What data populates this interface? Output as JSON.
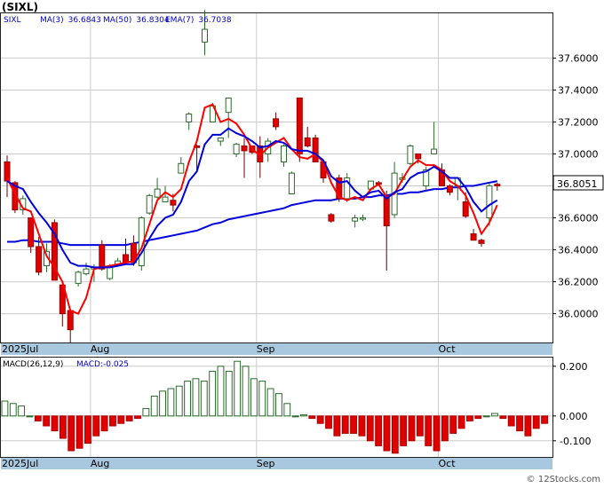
{
  "title": "(SIXL)",
  "watermark": "© 12Stocks.com",
  "price_legend": [
    {
      "label": "SIXL",
      "value": ""
    },
    {
      "label": "MA(3)",
      "value": "36.6843"
    },
    {
      "label": "MA(50)",
      "value": "36.8304"
    },
    {
      "label": "EMA(7)",
      "value": "36.7038"
    }
  ],
  "macd_legend": {
    "label": "MACD(26,12,9)",
    "value": "MACD:-0.025"
  },
  "last_price_tag": "36.8051",
  "colors": {
    "up_candle": "#2a6a2a",
    "down_candle": "#e00000",
    "ma3": "#ff0000",
    "ema7": "#0000dd",
    "ma50": "#0000dd",
    "legend_text": "#0000c0",
    "tick_label": "#000000",
    "month_band": "#a8c8e0",
    "grid": "#cccccc"
  },
  "chart_data": [
    {
      "type": "candlestick",
      "name": "price",
      "x_labels": [
        {
          "label": "2025Jul",
          "index": 0
        },
        {
          "label": "Aug",
          "index": 11
        },
        {
          "label": "Sep",
          "index": 32
        },
        {
          "label": "Oct",
          "index": 55
        }
      ],
      "ylim": [
        35.82,
        37.88
      ],
      "y_ticks": [
        "37.6000",
        "37.4000",
        "37.2000",
        "37.0000",
        "36.8000",
        "36.6000",
        "36.4000",
        "36.2000",
        "36.0000"
      ],
      "y_tick_values": [
        37.6,
        37.4,
        37.2,
        37.0,
        36.8,
        36.6,
        36.4,
        36.2,
        36.0
      ],
      "grid": true,
      "candles": [
        [
          36.95,
          36.83,
          36.99,
          36.73
        ],
        [
          36.82,
          36.65,
          36.83,
          36.63
        ],
        [
          36.65,
          36.72,
          36.74,
          36.62
        ],
        [
          36.6,
          36.42,
          36.6,
          36.38
        ],
        [
          36.42,
          36.26,
          36.48,
          36.24
        ],
        [
          36.3,
          36.39,
          36.44,
          36.26
        ],
        [
          36.57,
          36.21,
          36.59,
          36.21
        ],
        [
          36.18,
          36.0,
          36.2,
          35.92
        ],
        [
          36.02,
          35.9,
          36.03,
          35.82
        ],
        [
          36.19,
          36.26,
          36.27,
          36.17
        ],
        [
          36.25,
          36.28,
          36.32,
          36.24
        ],
        [
          36.28,
          36.29,
          36.31,
          36.2
        ],
        [
          36.43,
          36.28,
          36.46,
          36.27
        ],
        [
          36.22,
          36.29,
          36.31,
          36.21
        ],
        [
          36.31,
          36.33,
          36.35,
          36.3
        ],
        [
          36.37,
          36.32,
          36.47,
          36.32
        ],
        [
          36.44,
          36.32,
          36.49,
          36.3
        ],
        [
          36.3,
          36.6,
          36.61,
          36.27
        ],
        [
          36.63,
          36.74,
          36.75,
          36.62
        ],
        [
          36.73,
          36.78,
          36.85,
          36.72
        ],
        [
          36.7,
          36.73,
          36.8,
          36.7
        ],
        [
          36.71,
          36.68,
          36.75,
          36.64
        ],
        [
          36.88,
          36.94,
          36.98,
          36.88
        ],
        [
          37.2,
          37.25,
          37.26,
          37.15
        ],
        [
          37.05,
          37.04,
          37.06,
          36.9
        ],
        [
          37.7,
          37.78,
          37.9,
          37.62
        ],
        [
          37.2,
          37.3,
          37.32,
          37.2
        ],
        [
          37.08,
          37.1,
          37.1,
          37.05
        ],
        [
          37.26,
          37.35,
          37.35,
          37.1
        ],
        [
          37.0,
          37.06,
          37.07,
          36.98
        ],
        [
          37.05,
          37.02,
          37.1,
          36.85
        ],
        [
          37.05,
          37.01,
          37.03,
          37.0
        ],
        [
          37.05,
          36.95,
          37.11,
          36.85
        ],
        [
          37.0,
          37.08,
          37.1,
          36.95
        ],
        [
          37.22,
          37.17,
          37.26,
          37.15
        ],
        [
          36.95,
          37.05,
          37.06,
          36.92
        ],
        [
          36.75,
          36.88,
          36.89,
          36.75
        ],
        [
          37.35,
          37.0,
          37.35,
          36.95
        ],
        [
          37.1,
          37.05,
          37.17,
          37.04
        ],
        [
          37.1,
          36.95,
          37.12,
          36.95
        ],
        [
          36.95,
          36.85,
          36.96,
          36.82
        ],
        [
          36.62,
          36.58,
          36.63,
          36.57
        ],
        [
          36.85,
          36.72,
          36.87,
          36.7
        ],
        [
          36.72,
          36.85,
          36.88,
          36.7
        ],
        [
          36.58,
          36.6,
          36.62,
          36.54
        ],
        [
          36.6,
          36.6,
          36.62,
          36.58
        ],
        [
          36.78,
          36.83,
          36.83,
          36.77
        ],
        [
          36.82,
          36.81,
          36.83,
          36.8
        ],
        [
          36.73,
          36.55,
          36.77,
          36.27
        ],
        [
          36.62,
          36.88,
          36.95,
          36.6
        ],
        [
          36.84,
          36.85,
          36.88,
          36.82
        ],
        [
          36.94,
          37.05,
          37.06,
          36.93
        ],
        [
          37.0,
          36.97,
          37.0,
          36.94
        ],
        [
          36.8,
          36.9,
          36.92,
          36.77
        ],
        [
          37.0,
          37.03,
          37.2,
          37.0
        ],
        [
          36.9,
          36.8,
          36.94,
          36.8
        ],
        [
          36.8,
          36.76,
          36.81,
          36.74
        ],
        [
          36.8,
          36.85,
          36.85,
          36.71
        ],
        [
          36.7,
          36.61,
          36.76,
          36.6
        ],
        [
          36.5,
          36.46,
          36.53,
          36.46
        ],
        [
          36.46,
          36.44,
          36.47,
          36.42
        ],
        [
          36.6,
          36.8,
          36.82,
          36.55
        ],
        [
          36.81,
          36.8,
          36.82,
          36.77
        ]
      ],
      "series": [
        {
          "name": "MA(3)",
          "values": [
            36.85,
            36.75,
            36.66,
            36.64,
            36.5,
            36.36,
            36.29,
            36.2,
            36.02,
            36.0,
            36.1,
            36.28,
            36.29,
            36.3,
            36.31,
            36.32,
            36.33,
            36.41,
            36.56,
            36.71,
            36.76,
            36.73,
            36.78,
            36.95,
            37.08,
            37.29,
            37.31,
            37.2,
            37.22,
            37.19,
            37.12,
            37.03,
            36.99,
            37.04,
            37.07,
            37.1,
            37.03,
            36.98,
            36.97,
            37.0,
            36.95,
            36.82,
            36.73,
            36.71,
            36.73,
            36.71,
            36.78,
            36.81,
            36.73,
            36.75,
            36.84,
            36.92,
            36.96,
            36.93,
            36.93,
            36.9,
            36.83,
            36.8,
            36.74,
            36.63,
            36.5,
            36.57,
            36.68
          ]
        },
        {
          "name": "EMA(7)",
          "values": [
            36.83,
            36.8,
            36.78,
            36.7,
            36.63,
            36.57,
            36.5,
            36.4,
            36.32,
            36.3,
            36.3,
            36.29,
            36.29,
            36.29,
            36.3,
            36.31,
            36.31,
            36.38,
            36.47,
            36.55,
            36.6,
            36.62,
            36.7,
            36.83,
            36.89,
            37.06,
            37.12,
            37.12,
            37.16,
            37.13,
            37.11,
            37.08,
            37.04,
            37.05,
            37.08,
            37.07,
            37.03,
            37.02,
            37.02,
            37.0,
            36.96,
            36.86,
            36.82,
            36.83,
            36.77,
            36.73,
            36.76,
            36.77,
            36.72,
            36.76,
            36.78,
            36.85,
            36.88,
            36.89,
            36.92,
            36.89,
            36.85,
            36.85,
            36.79,
            36.7,
            36.64,
            36.68,
            36.71
          ]
        },
        {
          "name": "MA(50)",
          "values": [
            36.45,
            36.45,
            36.46,
            36.46,
            36.45,
            36.45,
            36.45,
            36.44,
            36.43,
            36.43,
            36.43,
            36.43,
            36.43,
            36.43,
            36.43,
            36.43,
            36.44,
            36.45,
            36.46,
            36.47,
            36.48,
            36.49,
            36.5,
            36.51,
            36.52,
            36.54,
            36.56,
            36.57,
            36.59,
            36.6,
            36.61,
            36.62,
            36.63,
            36.64,
            36.65,
            36.66,
            36.68,
            36.69,
            36.7,
            36.71,
            36.71,
            36.71,
            36.72,
            36.72,
            36.72,
            36.73,
            36.73,
            36.74,
            36.74,
            36.75,
            36.75,
            36.76,
            36.76,
            36.77,
            36.78,
            36.78,
            36.79,
            36.79,
            36.8,
            36.8,
            36.81,
            36.82,
            36.83
          ]
        }
      ]
    },
    {
      "type": "bar",
      "name": "MACD histogram",
      "ylim": [
        -0.165,
        0.235
      ],
      "y_ticks": [
        "0.200",
        "0.000",
        "-0.100"
      ],
      "y_tick_values": [
        0.2,
        0.0,
        -0.1
      ],
      "values": [
        0.06,
        0.05,
        0.04,
        0.0,
        -0.02,
        -0.04,
        -0.06,
        -0.09,
        -0.14,
        -0.13,
        -0.11,
        -0.08,
        -0.06,
        -0.04,
        -0.03,
        -0.02,
        -0.01,
        0.03,
        0.08,
        0.1,
        0.11,
        0.12,
        0.14,
        0.15,
        0.14,
        0.18,
        0.2,
        0.18,
        0.22,
        0.2,
        0.15,
        0.14,
        0.11,
        0.09,
        0.05,
        0.0,
        0.005,
        -0.01,
        -0.03,
        -0.05,
        -0.08,
        -0.07,
        -0.07,
        -0.08,
        -0.1,
        -0.12,
        -0.14,
        -0.15,
        -0.12,
        -0.1,
        -0.08,
        -0.12,
        -0.14,
        -0.1,
        -0.07,
        -0.05,
        -0.02,
        -0.01,
        0.0,
        0.01,
        -0.01,
        -0.04,
        -0.06,
        -0.08,
        -0.05,
        -0.03
      ]
    }
  ]
}
